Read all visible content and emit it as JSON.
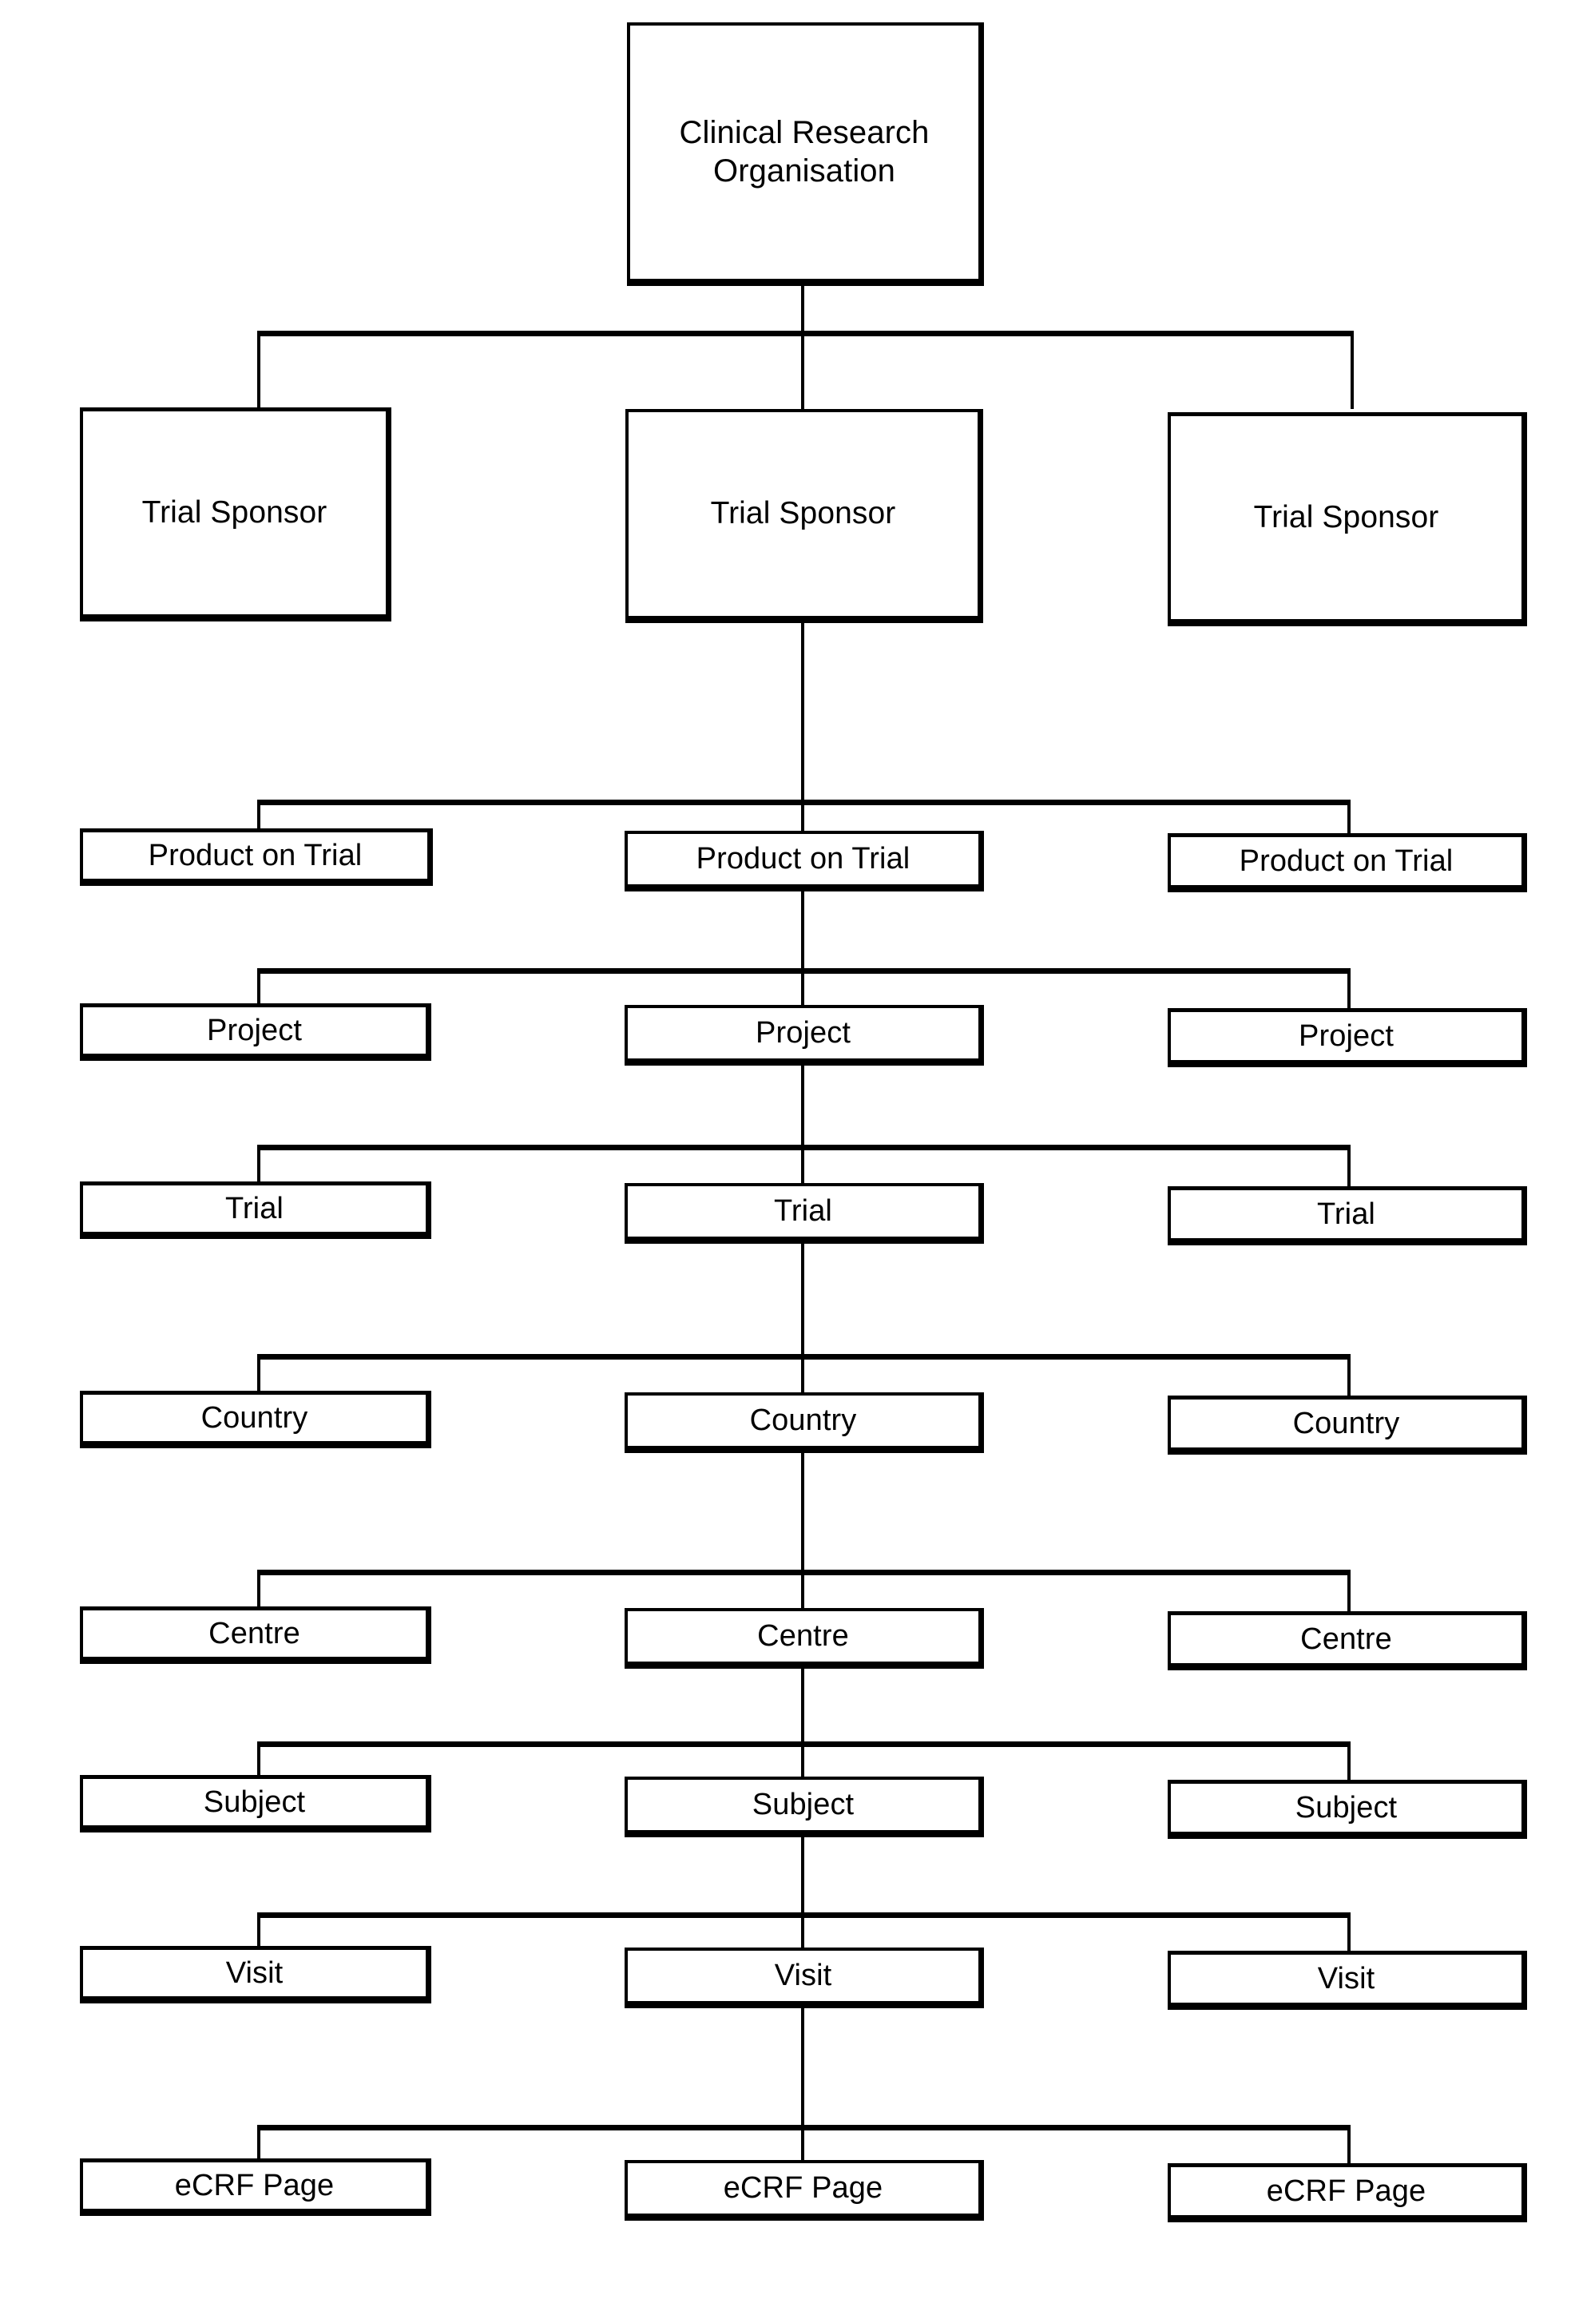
{
  "diagram": {
    "title": "Clinical Research Organisation data hierarchy",
    "type": "organisational-hierarchy",
    "orientation": "top-down",
    "columns": 3,
    "levels": 10,
    "line_color": "#000000",
    "box_fill": "#ffffff",
    "box_border_color": "#000000",
    "text_color": "#000000"
  },
  "root": {
    "label": "Clinical Research\nOrganisation",
    "line1": "Clinical Research",
    "line2": "Organisation"
  },
  "levels": [
    {
      "index": 1,
      "name": "trial-sponsor",
      "label": "Trial Sponsor",
      "nodes": [
        {
          "label": "Trial Sponsor",
          "column": "left"
        },
        {
          "label": "Trial Sponsor",
          "column": "center"
        },
        {
          "label": "Trial Sponsor",
          "column": "right"
        }
      ]
    },
    {
      "index": 2,
      "name": "product-on-trial",
      "label": "Product on Trial",
      "nodes": [
        {
          "label": "Product on Trial",
          "column": "left"
        },
        {
          "label": "Product on Trial",
          "column": "center"
        },
        {
          "label": "Product on Trial",
          "column": "right"
        }
      ]
    },
    {
      "index": 3,
      "name": "project",
      "label": "Project",
      "nodes": [
        {
          "label": "Project",
          "column": "left"
        },
        {
          "label": "Project",
          "column": "center"
        },
        {
          "label": "Project",
          "column": "right"
        }
      ]
    },
    {
      "index": 4,
      "name": "trial",
      "label": "Trial",
      "nodes": [
        {
          "label": "Trial",
          "column": "left"
        },
        {
          "label": "Trial",
          "column": "center"
        },
        {
          "label": "Trial",
          "column": "right"
        }
      ]
    },
    {
      "index": 5,
      "name": "country",
      "label": "Country",
      "nodes": [
        {
          "label": "Country",
          "column": "left"
        },
        {
          "label": "Country",
          "column": "center"
        },
        {
          "label": "Country",
          "column": "right"
        }
      ]
    },
    {
      "index": 6,
      "name": "centre",
      "label": "Centre",
      "nodes": [
        {
          "label": "Centre",
          "column": "left"
        },
        {
          "label": "Centre",
          "column": "center"
        },
        {
          "label": "Centre",
          "column": "right"
        }
      ]
    },
    {
      "index": 7,
      "name": "subject",
      "label": "Subject",
      "nodes": [
        {
          "label": "Subject",
          "column": "left"
        },
        {
          "label": "Subject",
          "column": "center"
        },
        {
          "label": "Subject",
          "column": "right"
        }
      ]
    },
    {
      "index": 8,
      "name": "visit",
      "label": "Visit",
      "nodes": [
        {
          "label": "Visit",
          "column": "left"
        },
        {
          "label": "Visit",
          "column": "center"
        },
        {
          "label": "Visit",
          "column": "right"
        }
      ]
    },
    {
      "index": 9,
      "name": "ecrf-page",
      "label": "eCRF Page",
      "nodes": [
        {
          "label": "eCRF Page",
          "column": "left"
        },
        {
          "label": "eCRF Page",
          "column": "center"
        },
        {
          "label": "eCRF Page",
          "column": "right"
        }
      ]
    }
  ]
}
